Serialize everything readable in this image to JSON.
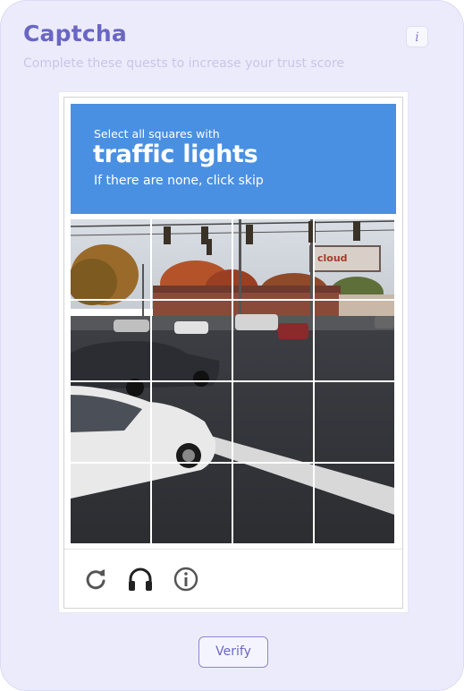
{
  "card": {
    "title": "Captcha",
    "subtitle": "Complete these quests to increase your trust score",
    "info_icon": "i"
  },
  "captcha": {
    "instruction_top": "Select all squares with",
    "target": "traffic lights",
    "instruction_bottom": "If there are none, click skip",
    "grid": {
      "rows": 4,
      "cols": 4
    },
    "controls": [
      "reload-icon",
      "headphones-icon",
      "info-circle-icon"
    ],
    "billboard_text": "cloud"
  },
  "actions": {
    "verify_label": "Verify"
  },
  "colors": {
    "card_bg": "#ecebfc",
    "accent": "#6a66c5",
    "captcha_header": "#4a90e2"
  }
}
